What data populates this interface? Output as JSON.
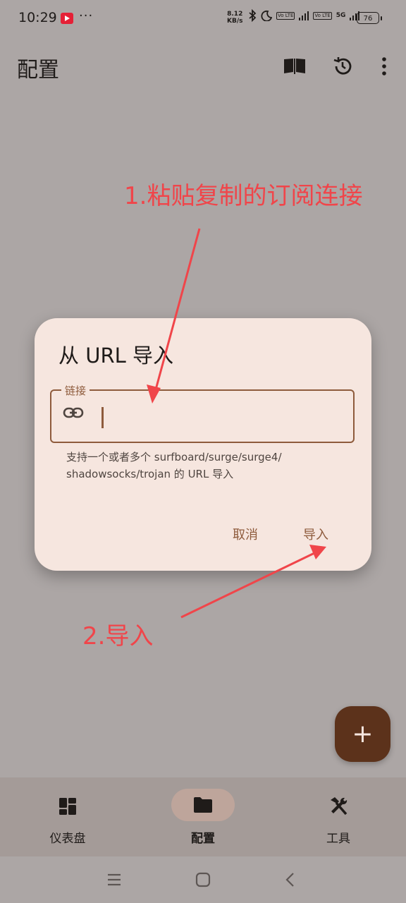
{
  "status_bar": {
    "time": "10:29",
    "more": "···",
    "speed_value": "8.12",
    "speed_unit": "KB/s",
    "volte_1": "Vo LTE",
    "volte_2": "Vo LTE",
    "network": "5G",
    "battery": "76",
    "icons": [
      "youtube-icon",
      "bluetooth-icon",
      "moon-icon",
      "signal-icon",
      "battery-icon"
    ]
  },
  "app_bar": {
    "title": "配置",
    "actions": [
      "book-icon",
      "history-icon",
      "more-vert-icon"
    ]
  },
  "annotations": {
    "step1": "1.粘贴复制的订阅连接",
    "step2": "2.导入",
    "arrow_color": "#f0454a"
  },
  "dialog": {
    "title": "从 URL 导入",
    "field_label": "链接",
    "field_value": "",
    "field_icon": "link-icon",
    "help_line1": "支持一个或者多个 surfboard/surge/surge4/",
    "help_line2": "shadowsocks/trojan 的 URL 导入",
    "cancel_label": "取消",
    "import_label": "导入"
  },
  "fab": {
    "label": "+",
    "icon": "add-icon"
  },
  "bottom_nav": {
    "items": [
      {
        "label": "仪表盘",
        "icon": "dashboard-icon",
        "active": false
      },
      {
        "label": "配置",
        "icon": "folder-icon",
        "active": true
      },
      {
        "label": "工具",
        "icon": "tools-icon",
        "active": false
      }
    ]
  },
  "system_nav": [
    "menu-icon",
    "home-icon",
    "back-icon"
  ],
  "colors": {
    "scrim_bg": "#aca6a5",
    "dialog_bg": "#f6e6df",
    "accent": "#8e5b3c",
    "fab_bg": "#5c321b",
    "annotation": "#f0454a"
  }
}
